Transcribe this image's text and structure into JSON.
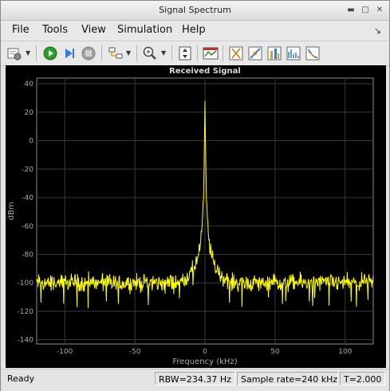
{
  "window": {
    "title": "Signal Spectrum"
  },
  "menu": {
    "items": [
      "File",
      "Tools",
      "View",
      "Simulation",
      "Help"
    ]
  },
  "toolbar": {
    "buttons": [
      "configure-icon",
      "run-icon",
      "step-icon",
      "stop-icon",
      "highlight-icon",
      "zoom-icon",
      "autoscale-icon",
      "measure-icon",
      "cursor-icon",
      "marker-icon",
      "peak-icon",
      "distortion-icon",
      "ccdf-icon"
    ]
  },
  "status": {
    "ready": "Ready",
    "rbw": "RBW=234.37 Hz",
    "sample_rate": "Sample rate=240 kHz",
    "time": "T=2.000"
  },
  "chart_data": {
    "type": "line",
    "title": "Received Signal",
    "xlabel": "Frequency (kHz)",
    "ylabel": "dBm",
    "xlim": [
      -120,
      120
    ],
    "ylim": [
      -143,
      44
    ],
    "xticks": [
      -100,
      -50,
      0,
      50,
      100
    ],
    "yticks": [
      40,
      20,
      0,
      -20,
      -40,
      -60,
      -80,
      -100,
      -120,
      -140
    ],
    "grid": true,
    "colors": {
      "background": "#000000",
      "line": "#ffff00",
      "grid": "#3a3a3a",
      "axes_text": "#aaaaaa"
    },
    "series": [
      {
        "x": [
          -120,
          -100,
          -80,
          -60,
          -40,
          -20,
          -12,
          -8,
          -5,
          -3,
          -2,
          -1,
          -0.5,
          0,
          0.5,
          1,
          2,
          3,
          5,
          8,
          12,
          20,
          40,
          60,
          80,
          100,
          120
        ],
        "values": [
          -100,
          -100,
          -100,
          -100,
          -100,
          -100,
          -96,
          -90,
          -82,
          -72,
          -60,
          -40,
          -10,
          28,
          -10,
          -40,
          -60,
          -72,
          -82,
          -90,
          -96,
          -100,
          -100,
          -100,
          -100,
          -100,
          -100
        ]
      }
    ],
    "noise_floor": -100,
    "noise_spread": [
      -118,
      -88
    ]
  }
}
